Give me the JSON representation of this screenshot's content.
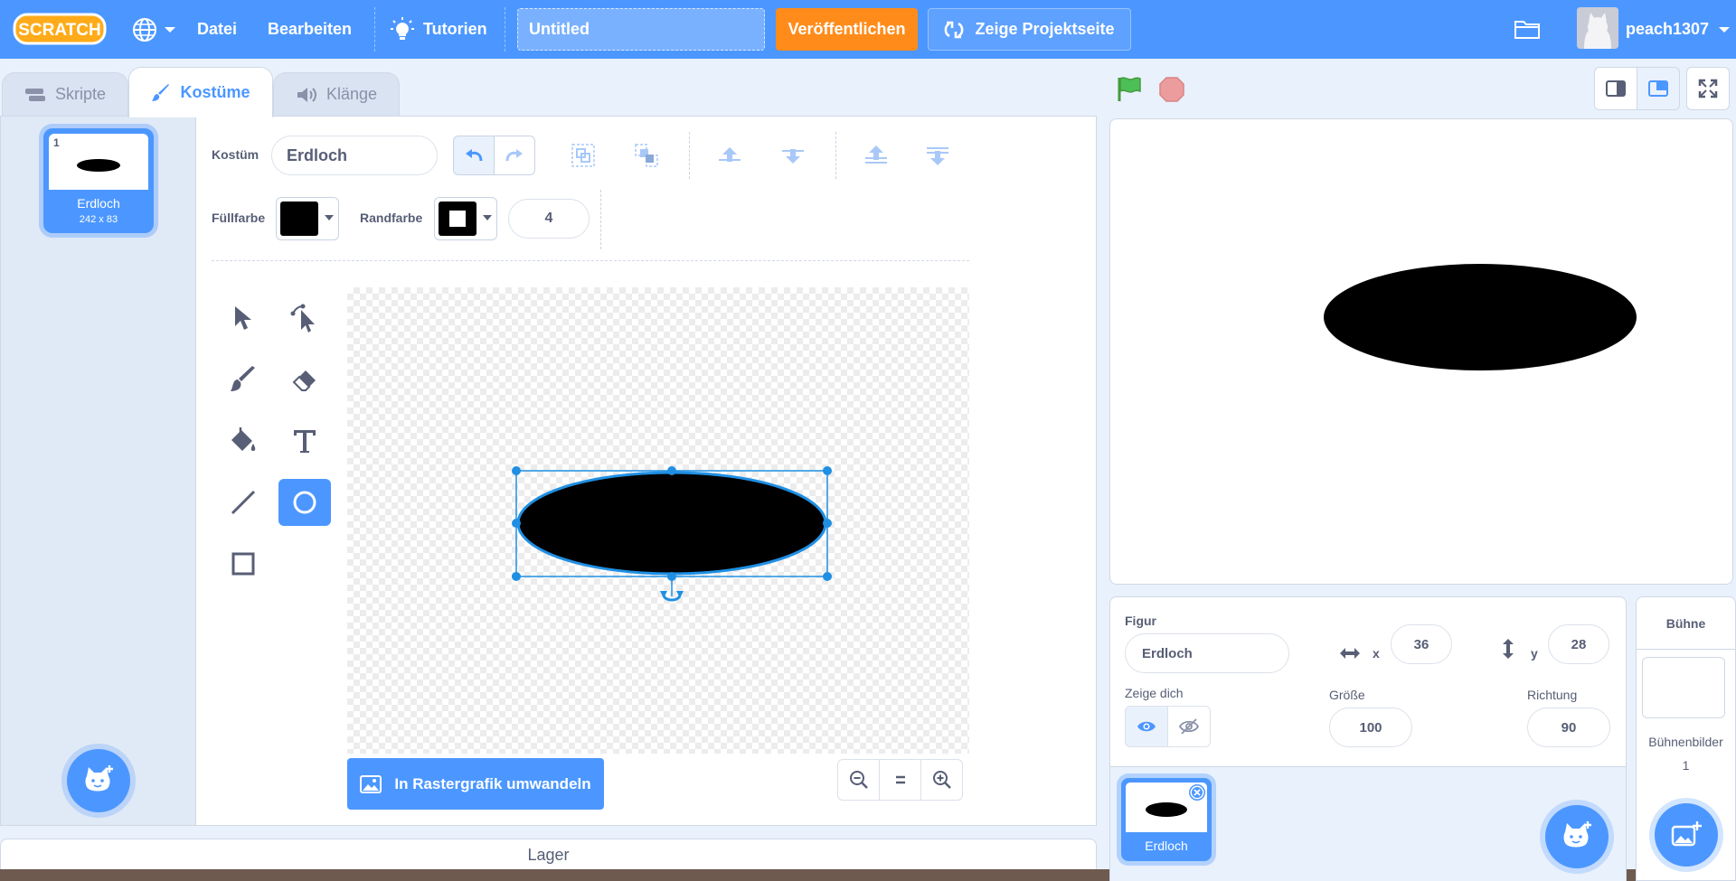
{
  "menubar": {
    "logo_text": "SCRATCH",
    "file": "Datei",
    "edit": "Bearbeiten",
    "tutorials": "Tutorien",
    "project_title": "Untitled",
    "share": "Veröffentlichen",
    "project_page": "Zeige Projektseite",
    "username": "peach1307"
  },
  "tabs": {
    "code": "Skripte",
    "costumes": "Kostüme",
    "sounds": "Klänge"
  },
  "costume_list": {
    "items": [
      {
        "number": "1",
        "name": "Erdloch",
        "size": "242 x 83"
      }
    ]
  },
  "paint_editor": {
    "costume_label": "Kostüm",
    "costume_name": "Erdloch",
    "fill_label": "Füllfarbe",
    "fill_color": "#000000",
    "outline_label": "Randfarbe",
    "outline_color": "#000000",
    "outline_width": "4",
    "convert_button": "In Rastergrafik umwandeln",
    "tools": [
      "select",
      "reshape",
      "brush",
      "eraser",
      "fill",
      "text",
      "line",
      "circle",
      "rectangle"
    ],
    "active_tool": "circle"
  },
  "storage": {
    "label": "Lager"
  },
  "sprite_info": {
    "sprite_label": "Figur",
    "sprite_name": "Erdloch",
    "x_label": "x",
    "x_value": "36",
    "y_label": "y",
    "y_value": "28",
    "show_label": "Zeige dich",
    "size_label": "Größe",
    "size_value": "100",
    "direction_label": "Richtung",
    "direction_value": "90",
    "sprites": [
      {
        "name": "Erdloch"
      }
    ]
  },
  "stage_panel": {
    "title": "Bühne",
    "backdrops_label": "Bühnenbilder",
    "backdrops_count": "1"
  },
  "colors": {
    "accent": "#4c97ff",
    "share": "#ff8c1a",
    "green_flag": "#4cbf56",
    "stop": "#ec9c9c"
  }
}
